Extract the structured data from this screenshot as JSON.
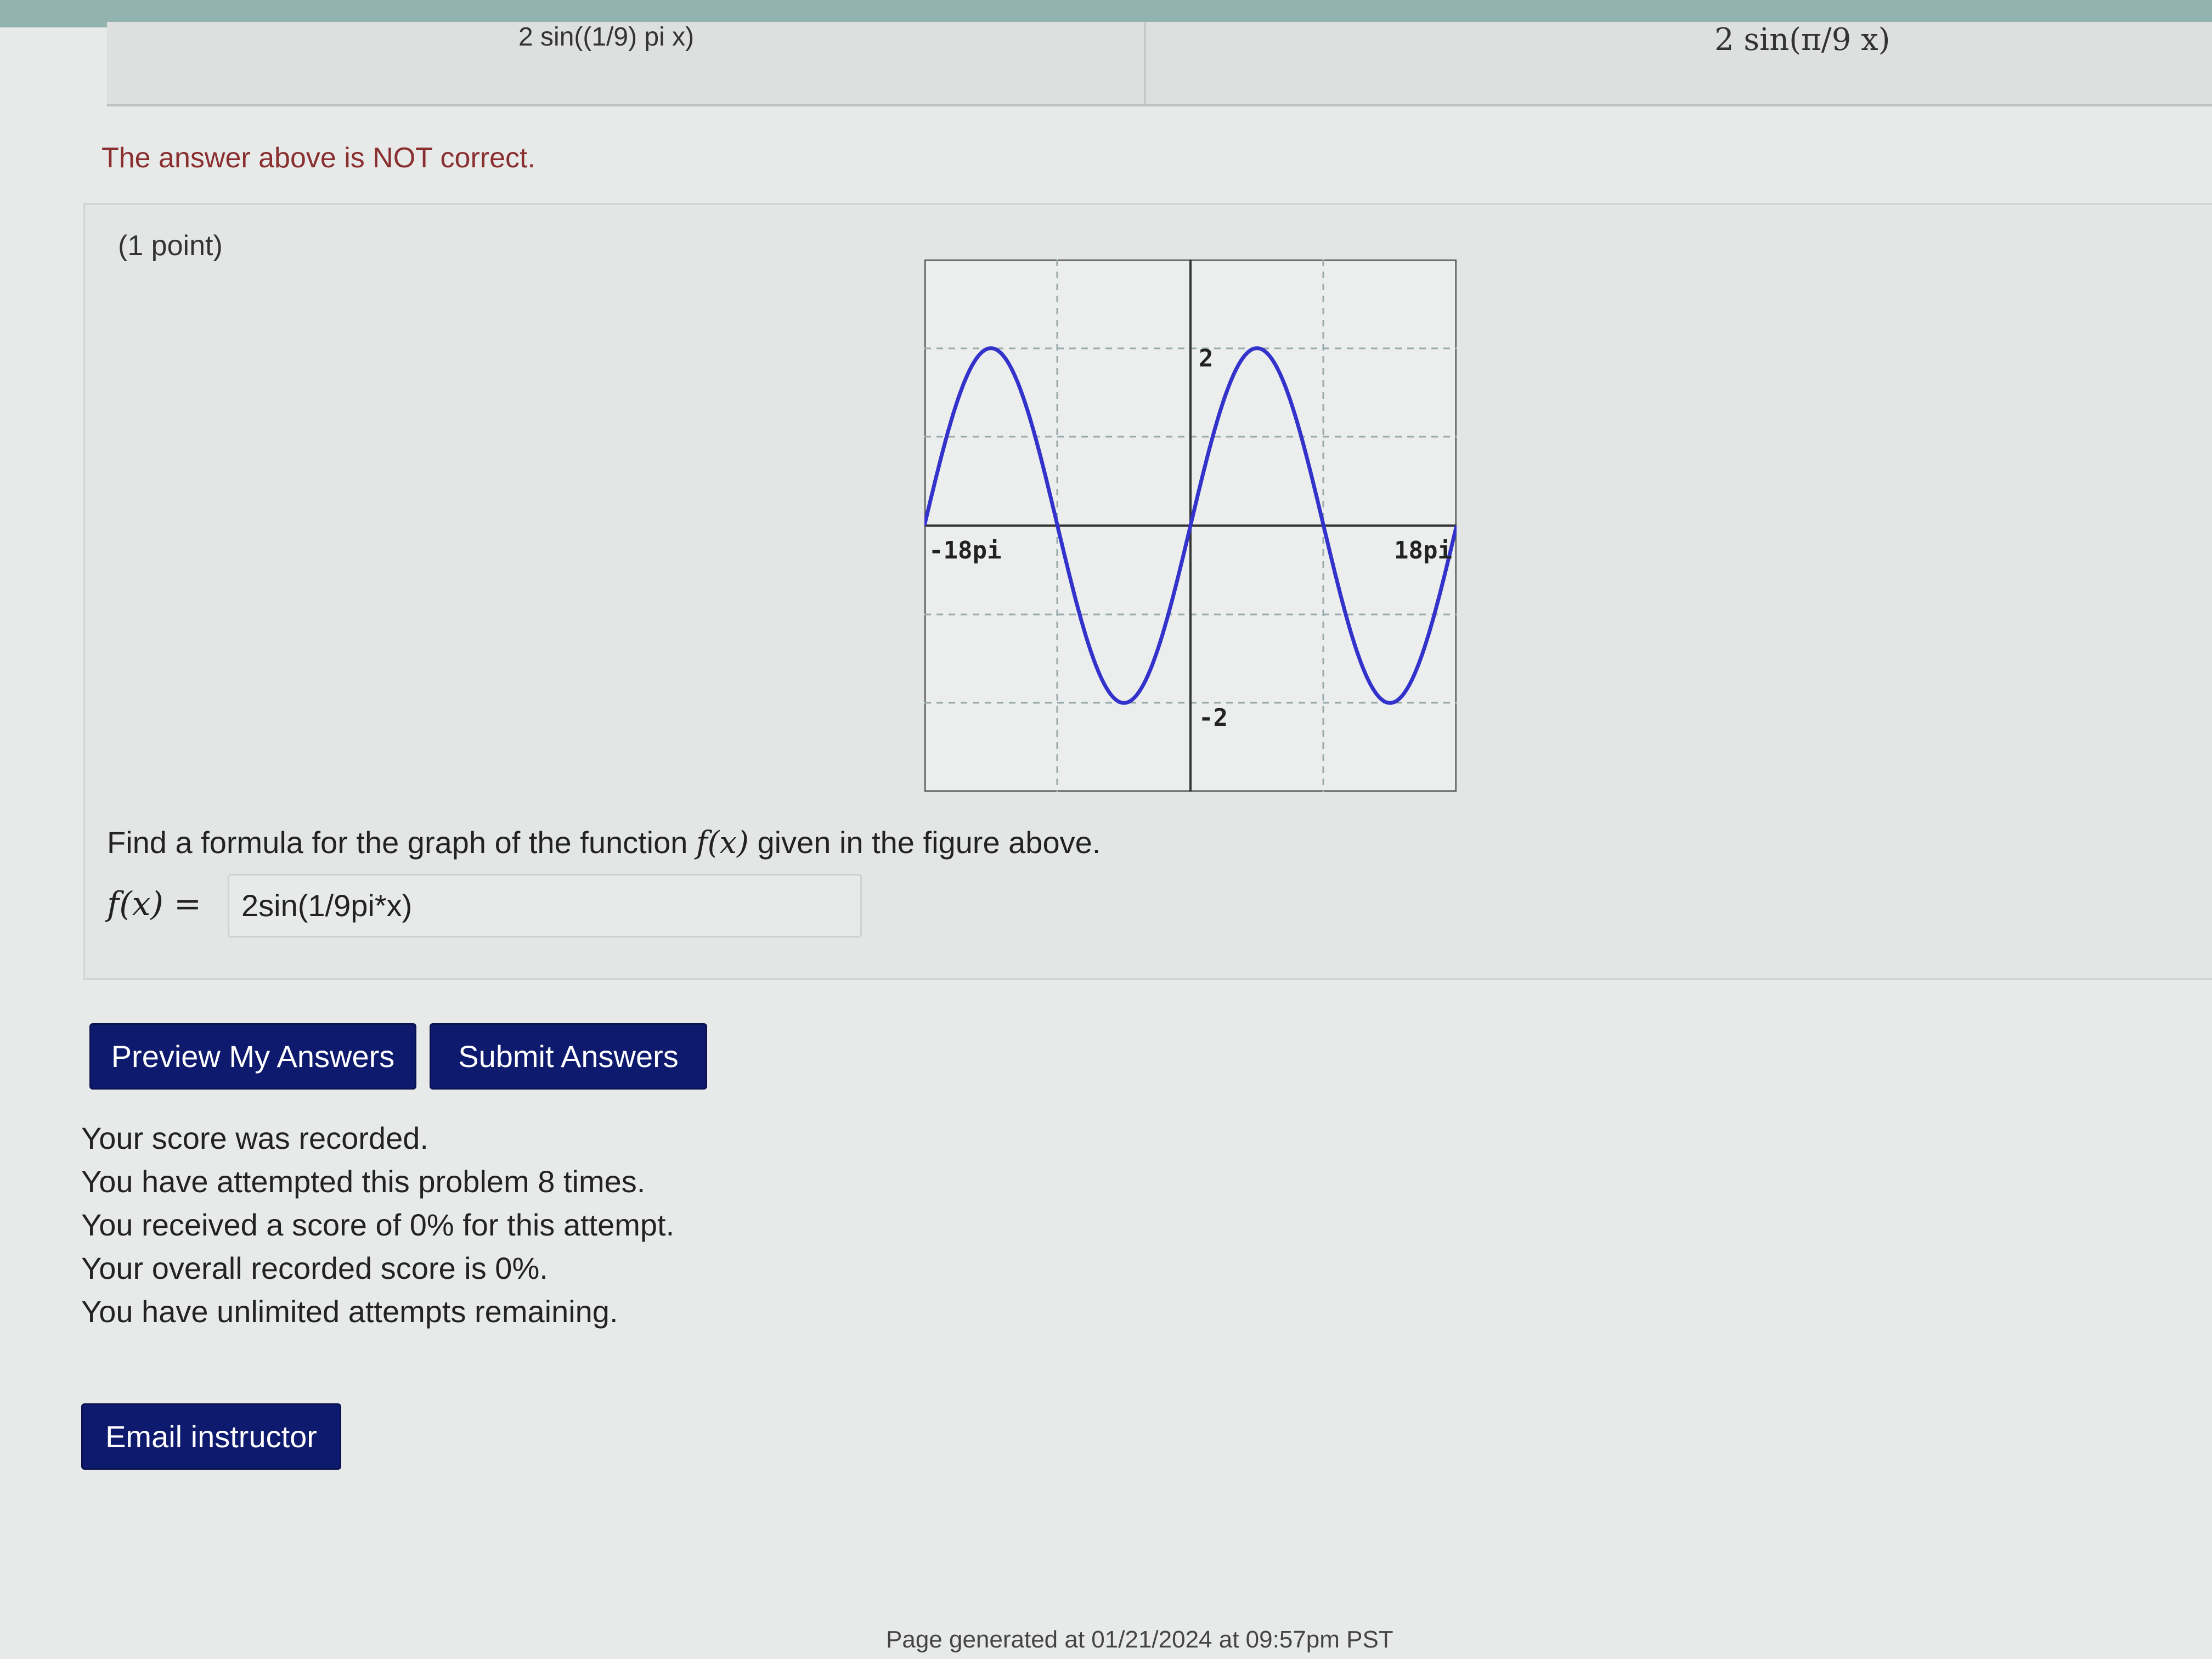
{
  "previous_answers": {
    "left": "2 sin((1/9) pi x)",
    "right": "2 sin(π/9 x)"
  },
  "feedback_message": "The answer above is NOT correct.",
  "problem": {
    "points": "(1 point)",
    "question_prefix": "Find a formula for the graph of the function ",
    "question_function": "f(x)",
    "question_suffix": " given in the figure above.",
    "fx_label": "f(x) =",
    "answer_value": "2sin(1/9pi*x)"
  },
  "graph": {
    "labels": {
      "x_min": "-18pi",
      "x_max": "18pi",
      "y_max": "2",
      "y_min": "-2"
    },
    "curve_color": "#3333cc"
  },
  "buttons": {
    "preview": "Preview My Answers",
    "submit": "Submit Answers",
    "email": "Email instructor"
  },
  "score_lines": [
    "Your score was recorded.",
    "You have attempted this problem 8 times.",
    "You received a score of 0% for this attempt.",
    "Your overall recorded score is 0%.",
    "You have unlimited attempts remaining."
  ],
  "footer": "Page generated at 01/21/2024 at 09:57pm PST"
}
